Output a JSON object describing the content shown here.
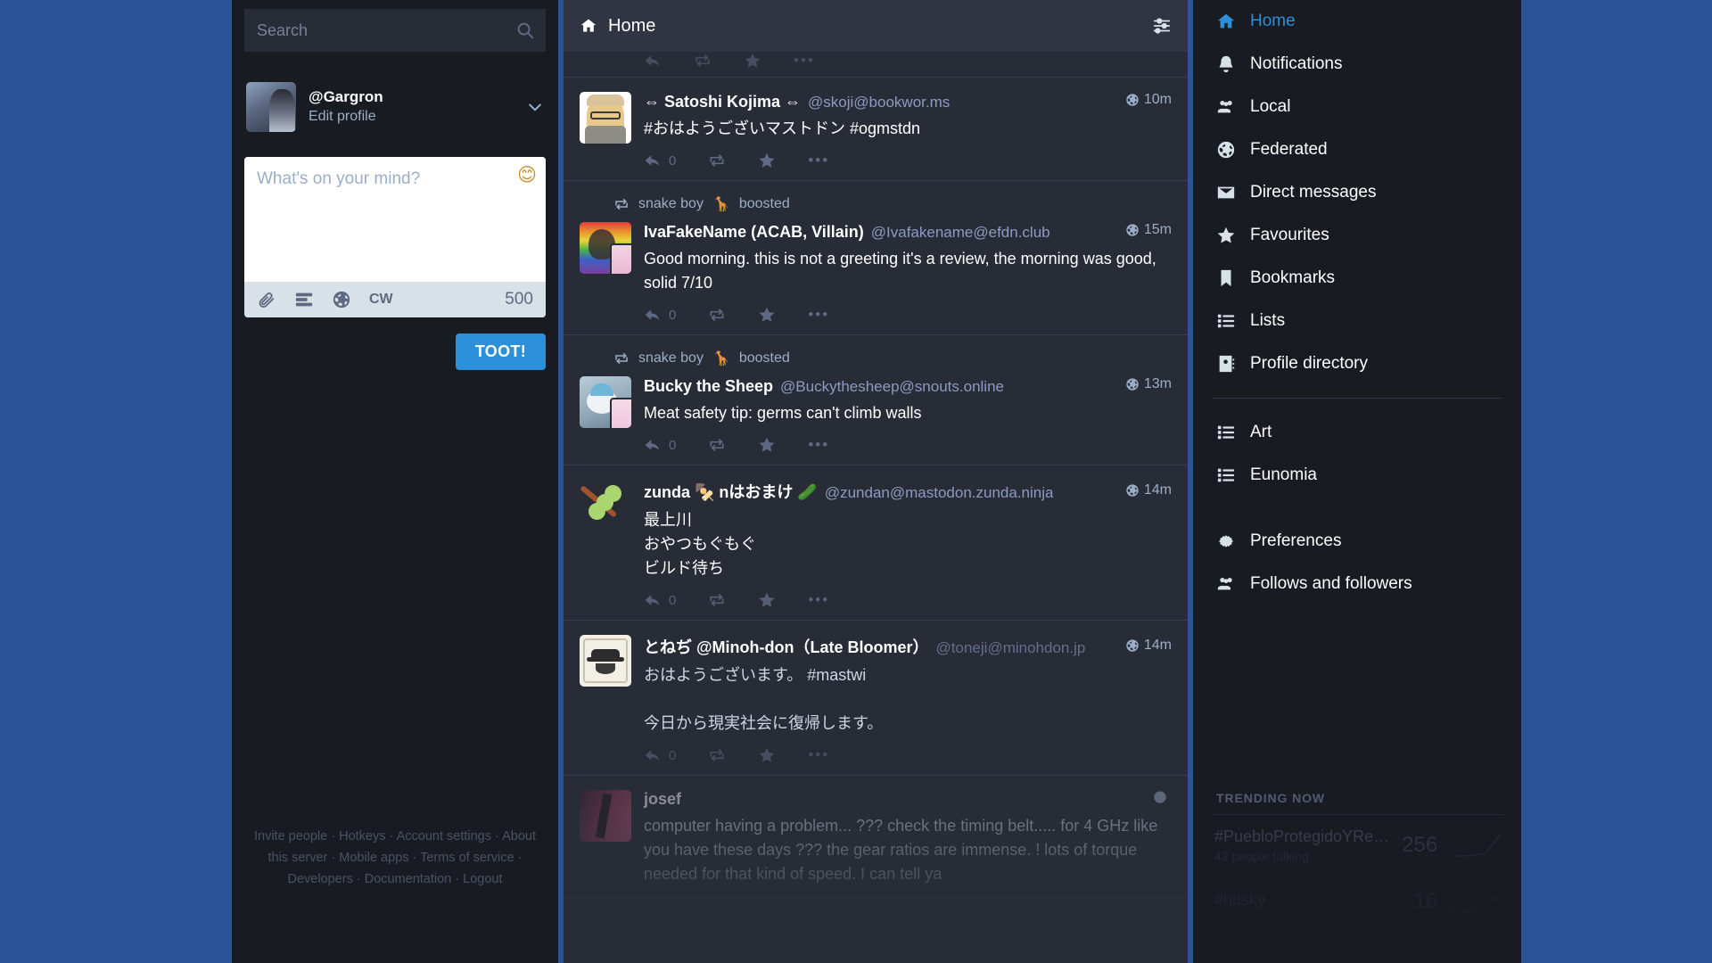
{
  "search": {
    "placeholder": "Search",
    "value": "",
    "icon": "search-icon"
  },
  "account": {
    "handle": "@Gargron",
    "edit_label": "Edit profile",
    "chevron_icon": "chevron-down-icon"
  },
  "composer": {
    "placeholder": "What's on your mind?",
    "value": "",
    "emoji_icon": "emoji-picker-icon",
    "attach_icon": "paperclip-icon",
    "poll_icon": "poll-icon",
    "visibility_icon": "globe-icon",
    "cw_label": "CW",
    "char_count": "500",
    "toot_label": "TOOT!"
  },
  "footer_links": [
    "Invite people",
    "Hotkeys",
    "Account settings",
    "About this server",
    "Mobile apps",
    "Terms of service",
    "Developers",
    "Documentation",
    "Logout"
  ],
  "column": {
    "title": "Home",
    "home_icon": "home-icon",
    "settings_icon": "sliders-icon"
  },
  "statuses": [
    {
      "id": "clipped",
      "clipped": true,
      "actions": {
        "reply_count": "",
        "reply_icon": "reply-icon",
        "boost_icon": "boost-icon",
        "fav_icon": "star-icon",
        "more_icon": "ellipsis-icon"
      }
    },
    {
      "id": "satoshi",
      "display_name": "⇔ Satoshi Kojima ⇔",
      "acct": "@skoji@bookwor.ms",
      "text": "#おはようございマストドン #ogmstdn",
      "time": "10m",
      "visibility_icon": "globe-icon",
      "actions": {
        "reply_count": "0",
        "reply_icon": "reply-icon",
        "boost_icon": "boost-icon",
        "fav_icon": "star-icon",
        "more_icon": "ellipsis-icon"
      }
    },
    {
      "id": "ivafakename",
      "boost_by": "snake boy 🐍 boosted",
      "boost_name": "snake boy",
      "boost_suffix": "boosted",
      "boost_icon": "boost-icon",
      "display_name": "IvaFakeName (ACAB, Villain)",
      "acct": "@Ivafakename@efdn.club",
      "text": "Good morning. this is not a greeting it's a review, the morning was good, solid 7/10",
      "time": "15m",
      "visibility_icon": "globe-icon",
      "actions": {
        "reply_count": "0",
        "reply_icon": "reply-icon",
        "boost_icon": "boost-icon",
        "fav_icon": "star-icon",
        "more_icon": "ellipsis-icon"
      }
    },
    {
      "id": "bucky",
      "boost_name": "snake boy",
      "boost_suffix": "boosted",
      "boost_icon": "boost-icon",
      "display_name": "Bucky the Sheep",
      "acct": "@Buckythesheep@snouts.online",
      "text": "Meat safety tip: germs can't climb walls",
      "time": "13m",
      "visibility_icon": "globe-icon",
      "actions": {
        "reply_count": "0",
        "reply_icon": "reply-icon",
        "boost_icon": "boost-icon",
        "fav_icon": "star-icon",
        "more_icon": "ellipsis-icon"
      }
    },
    {
      "id": "zunda",
      "display_name": "zunda 🍢 nはおまけ 🥒",
      "acct": "@zundan@mastodon.zunda.ninja",
      "text": "最上川\nおやつもぐもぐ\nビルド待ち",
      "time": "14m",
      "visibility_icon": "globe-icon",
      "actions": {
        "reply_count": "0",
        "reply_icon": "reply-icon",
        "boost_icon": "boost-icon",
        "fav_icon": "star-icon",
        "more_icon": "ellipsis-icon"
      }
    },
    {
      "id": "toneji",
      "display_name": "とねぢ @Minoh-don（Late Bloomer）",
      "acct": "@toneji@minohdon.jp",
      "text": "おはようございます。 #mastwi\n\n今日から現実社会に復帰します。",
      "time": "14m",
      "visibility_icon": "globe-icon",
      "actions": {
        "reply_count": "0",
        "reply_icon": "reply-icon",
        "boost_icon": "boost-icon",
        "fav_icon": "star-icon",
        "more_icon": "ellipsis-icon"
      }
    },
    {
      "id": "josef",
      "display_name": "josef",
      "acct": "",
      "text": "computer having a problem... ??? check the timing belt.....  for 4 GHz like you have these days ??? the gear ratios are immense. ! lots of torque needed for that kind of speed.  I can tell ya",
      "time": "",
      "visibility_icon": "globe-icon",
      "actions": {
        "reply_count": "",
        "reply_icon": "reply-icon",
        "boost_icon": "boost-icon",
        "fav_icon": "star-icon",
        "more_icon": "ellipsis-icon"
      }
    }
  ],
  "nav": {
    "primary": [
      {
        "label": "Home",
        "icon": "home-icon",
        "active": true
      },
      {
        "label": "Notifications",
        "icon": "bell-icon",
        "active": false
      },
      {
        "label": "Local",
        "icon": "users-icon",
        "active": false
      },
      {
        "label": "Federated",
        "icon": "globe-icon",
        "active": false
      },
      {
        "label": "Direct messages",
        "icon": "envelope-icon",
        "active": false
      },
      {
        "label": "Favourites",
        "icon": "star-icon",
        "active": false
      },
      {
        "label": "Bookmarks",
        "icon": "bookmark-icon",
        "active": false
      },
      {
        "label": "Lists",
        "icon": "list-icon",
        "active": false
      },
      {
        "label": "Profile directory",
        "icon": "address-book-icon",
        "active": false
      }
    ],
    "lists": [
      {
        "label": "Art",
        "icon": "list-icon"
      },
      {
        "label": "Eunomia",
        "icon": "list-icon"
      }
    ],
    "settings": [
      {
        "label": "Preferences",
        "icon": "gear-icon"
      },
      {
        "label": "Follows and followers",
        "icon": "users-icon"
      }
    ]
  },
  "trending": {
    "heading": "TRENDING NOW",
    "items": [
      {
        "tag": "#PuebloProtegidoYRe…",
        "people": "42 people talking",
        "count": "256"
      },
      {
        "tag": "#husky",
        "people": "",
        "count": "16"
      }
    ]
  },
  "colors": {
    "page_bg": "#2b5397",
    "panel_bg": "#191b22",
    "timeline_bg": "#282c37",
    "header_bg": "#313543",
    "accent": "#2b90d9",
    "text_primary": "#ffffff",
    "text_muted": "#9baec8"
  }
}
